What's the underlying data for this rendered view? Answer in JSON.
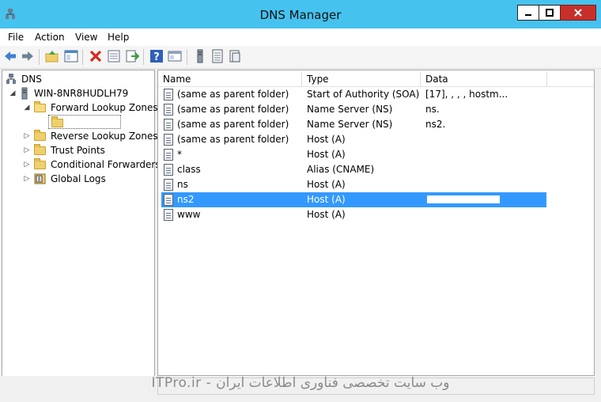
{
  "window": {
    "title": "DNS Manager"
  },
  "menu": [
    "File",
    "Action",
    "View",
    "Help"
  ],
  "toolbar": {
    "icons": [
      "back-icon",
      "forward-icon",
      "up-folder-icon",
      "show-hide-tree-icon",
      "delete-icon",
      "properties-icon",
      "export-icon",
      "help-icon",
      "console-icon",
      "server-icon",
      "list-icon",
      "refresh-icon"
    ]
  },
  "tree": {
    "root": "DNS",
    "server": "WIN-8NR8HUDLH79",
    "forward": "Forward Lookup Zones",
    "zone": "",
    "reverse": "Reverse Lookup Zones",
    "trust": "Trust Points",
    "conditional": "Conditional Forwarders",
    "logs": "Global Logs"
  },
  "list": {
    "columns": [
      "Name",
      "Type",
      "Data"
    ],
    "rows": [
      {
        "name": "(same as parent folder)",
        "type": "Start of Authority (SOA)",
        "data": "[17], ,  ,  , hostm..."
      },
      {
        "name": "(same as parent folder)",
        "type": "Name Server (NS)",
        "data": "ns."
      },
      {
        "name": "(same as parent folder)",
        "type": "Name Server (NS)",
        "data": "ns2."
      },
      {
        "name": "(same as parent folder)",
        "type": "Host (A)",
        "data": ""
      },
      {
        "name": "*",
        "type": "Host (A)",
        "data": ""
      },
      {
        "name": "class",
        "type": "Alias (CNAME)",
        "data": ""
      },
      {
        "name": "ns",
        "type": "Host (A)",
        "data": ""
      },
      {
        "name": "ns2",
        "type": "Host (A)",
        "data": ""
      },
      {
        "name": "www",
        "type": "Host (A)",
        "data": ""
      }
    ],
    "selected_index": 7
  },
  "watermark": "ITPro.ir - وب سایت تخصصی فناوری اطلاعات ایران",
  "colors": {
    "titlebar": "#46c2ee",
    "selection": "#3399ff",
    "close": "#c7302a"
  }
}
